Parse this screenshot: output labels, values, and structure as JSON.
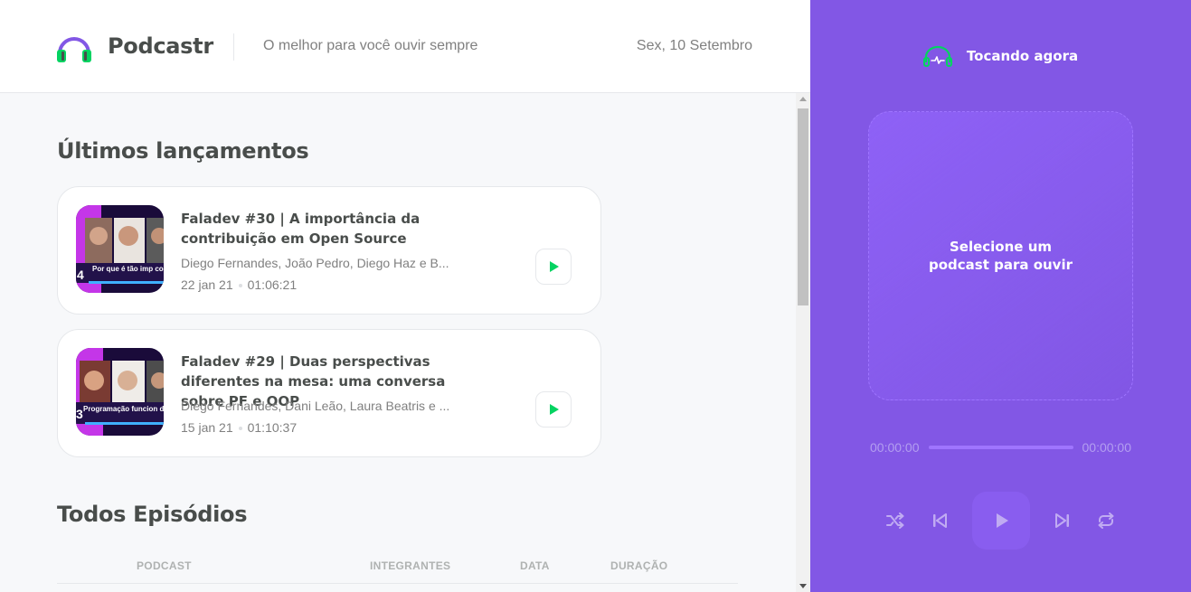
{
  "header": {
    "brand": "Podcastr",
    "tagline": "O melhor para você ouvir sempre",
    "date": "Sex, 10 Setembro",
    "logo_icon": "headphones-icon"
  },
  "latest": {
    "title": "Últimos lançamentos",
    "episodes": [
      {
        "title": "Faladev #30 | A importância da contribuição em Open Source",
        "members": "Diego Fernandes, João Pedro, Diego Haz e B...",
        "date": "22 jan 21",
        "duration": "01:06:21",
        "thumb_caption": "Por que é tão imp contribuir em Open S",
        "thumb_number": "4"
      },
      {
        "title": "Faladev #29 | Duas perspectivas diferentes na mesa: uma conversa sobre PF e OOP",
        "members": "Diego Fernandes, Dani Leão, Laura Beatris e ...",
        "date": "15 jan 21",
        "duration": "01:10:37",
        "thumb_caption": "Programação funcion devs orientados a o",
        "thumb_number": "3"
      }
    ]
  },
  "all": {
    "title": "Todos Episódios",
    "columns": [
      "PODCAST",
      "INTEGRANTES",
      "DATA",
      "DURAÇÃO"
    ]
  },
  "player": {
    "title": "Tocando agora",
    "empty_message": "Selecione um podcast para ouvir",
    "current_time": "00:00:00",
    "total_time": "00:00:00",
    "progress": 0,
    "controls": [
      "shuffle-icon",
      "previous-icon",
      "play-icon",
      "next-icon",
      "repeat-icon"
    ]
  },
  "colors": {
    "purple": "#8257e5",
    "green": "#04d361",
    "text_dark": "#494d4b",
    "text_muted": "#808080"
  }
}
